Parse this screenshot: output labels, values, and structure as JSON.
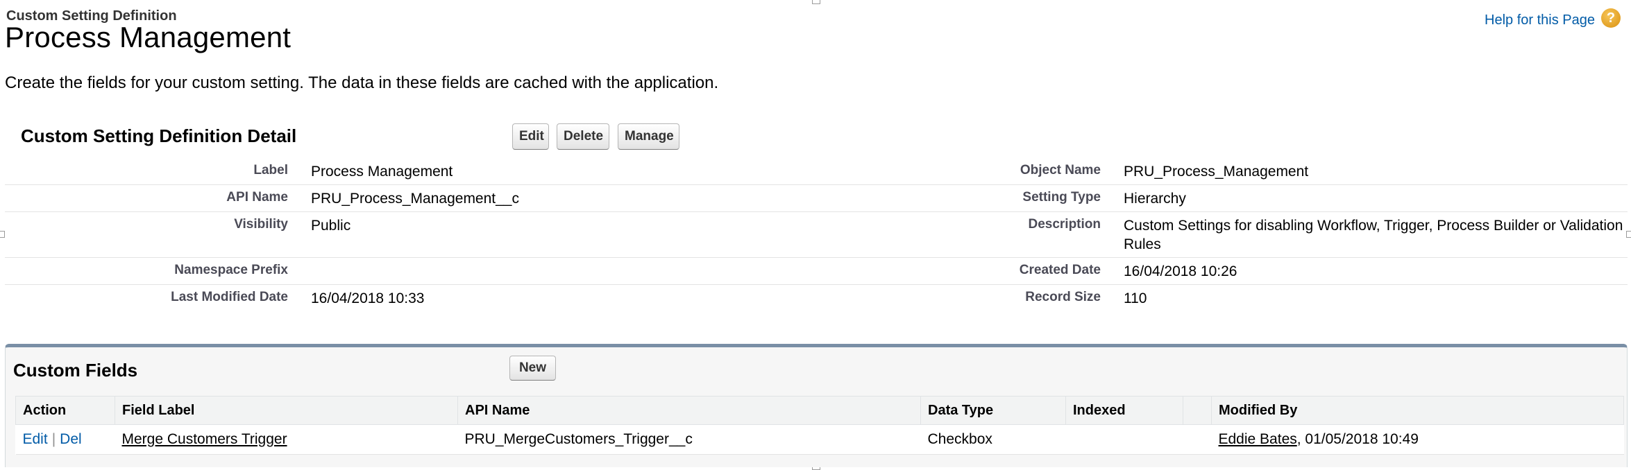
{
  "header": {
    "page_type": "Custom Setting Definition",
    "title": "Process Management",
    "help_link": "Help for this Page",
    "help_icon": "?",
    "description": "Create the fields for your custom setting. The data in these fields are cached with the application."
  },
  "detail": {
    "section_title": "Custom Setting Definition Detail",
    "buttons": {
      "edit": "Edit",
      "delete": "Delete",
      "manage": "Manage"
    },
    "rows": [
      {
        "left_label": "Label",
        "left_value": "Process Management",
        "right_label": "Object Name",
        "right_value": "PRU_Process_Management"
      },
      {
        "left_label": "API Name",
        "left_value": "PRU_Process_Management__c",
        "right_label": "Setting Type",
        "right_value": "Hierarchy"
      },
      {
        "left_label": "Visibility",
        "left_value": "Public",
        "right_label": "Description",
        "right_value": "Custom Settings for disabling Workflow, Trigger, Process Builder or Validation Rules"
      },
      {
        "left_label": "Namespace Prefix",
        "left_value": "",
        "right_label": "Created Date",
        "right_value": "16/04/2018 10:26"
      },
      {
        "left_label": "Last Modified Date",
        "left_value": "16/04/2018 10:33",
        "right_label": "Record Size",
        "right_value": "110"
      }
    ]
  },
  "custom_fields": {
    "title": "Custom Fields",
    "new_button": "New",
    "columns": [
      "Action",
      "Field Label",
      "API Name",
      "Data Type",
      "Indexed",
      "",
      "Modified By"
    ],
    "rows": [
      {
        "edit_action": "Edit",
        "separator": "|",
        "del_action": "Del",
        "field_label": "Merge Customers Trigger",
        "api_name": "PRU_MergeCustomers_Trigger__c",
        "data_type": "Checkbox",
        "indexed": "",
        "blank": "",
        "modified_by_user": "Eddie Bates",
        "modified_by_date": ", 01/05/2018 10:49"
      }
    ]
  },
  "colors": {
    "link": "#015ba7",
    "related_list_border": "#7a8fa6",
    "help_icon": "#d9900e"
  }
}
